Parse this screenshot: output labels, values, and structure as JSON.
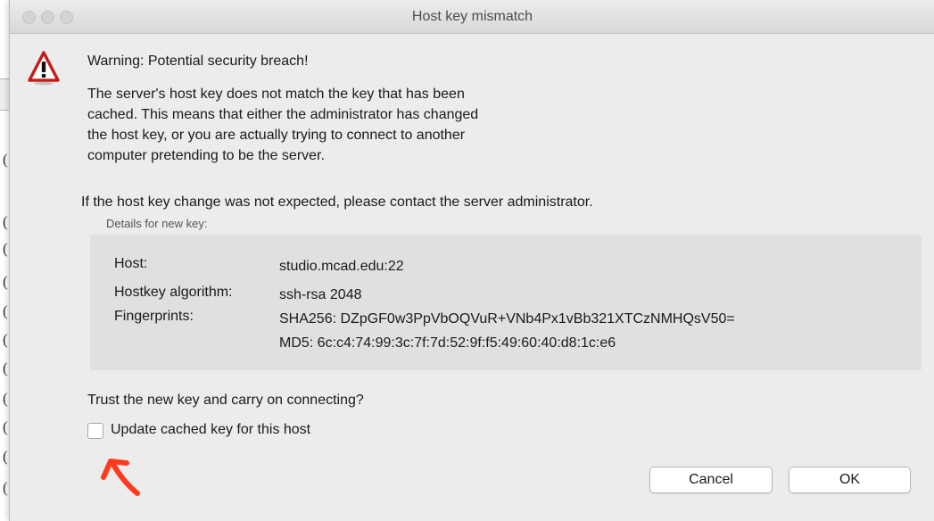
{
  "window": {
    "title": "Host key mismatch"
  },
  "warning": {
    "icon": "warning-triangle-icon",
    "heading": "Warning: Potential security breach!",
    "lines": [
      "The server's host key does not match the key that has been",
      "cached. This means that either the administrator has changed",
      "the host key, or you are actually trying to connect to another",
      "computer pretending to be the server."
    ],
    "note": "If the host key change was not expected, please contact the server administrator."
  },
  "details": {
    "group_label": "Details for new key:",
    "host_label": "Host:",
    "host_value": "studio.mcad.edu:22",
    "algorithm_label": "Hostkey algorithm:",
    "algorithm_value": "ssh-rsa 2048",
    "fingerprints_label": "Fingerprints:",
    "fingerprint_sha256": "SHA256: DZpGF0w3PpVbOQVuR+VNb4Px1vBb321XTCzNMHQsV50=",
    "fingerprint_md5": "MD5: 6c:c4:74:99:3c:7f:7d:52:9f:f5:49:60:40:d8:1c:e6"
  },
  "prompt": {
    "question": "Trust the new key and carry on connecting?",
    "checkbox_label": "Update cached key for this host",
    "checkbox_checked": false
  },
  "buttons": {
    "cancel": "Cancel",
    "ok": "OK"
  },
  "colors": {
    "dialog_bg": "#ececec",
    "details_bg": "#e0e0e0",
    "warning_red": "#d41f1f",
    "annotation_arrow": "#ff3b1f"
  }
}
